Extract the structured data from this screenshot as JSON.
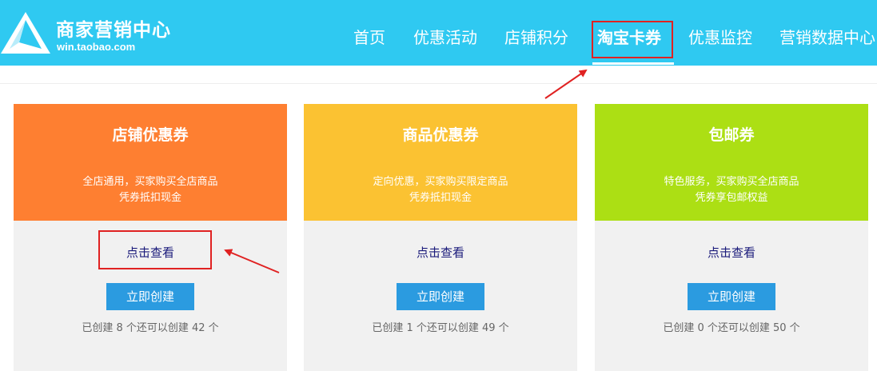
{
  "header": {
    "logo_title": "商家营销中心",
    "logo_url": "win.taobao.com",
    "nav": [
      {
        "label": "首页"
      },
      {
        "label": "优惠活动"
      },
      {
        "label": "店铺积分"
      },
      {
        "label": "淘宝卡券",
        "active": true
      },
      {
        "label": "优惠监控"
      },
      {
        "label": "营销数据中心"
      }
    ]
  },
  "cards": [
    {
      "title": "店铺优惠券",
      "desc_line1": "全店通用，买家购买全店商品",
      "desc_line2": "凭券抵扣现金",
      "view_label": "点击查看",
      "create_label": "立即创建",
      "count_text": "已创建 8 个还可以创建 42 个",
      "color": "#fe7f31"
    },
    {
      "title": "商品优惠券",
      "desc_line1": "定向优惠，买家购买限定商品",
      "desc_line2": "凭券抵扣现金",
      "view_label": "点击查看",
      "create_label": "立即创建",
      "count_text": "已创建 1 个还可以创建 49 个",
      "color": "#fbc232"
    },
    {
      "title": "包邮券",
      "desc_line1": "特色服务，买家购买全店商品",
      "desc_line2": "凭券享包邮权益",
      "view_label": "点击查看",
      "create_label": "立即创建",
      "count_text": "已创建 0 个还可以创建 50 个",
      "color": "#acdf14"
    }
  ],
  "colors": {
    "header_bg": "#2fc9f1",
    "annotation_red": "#e02222",
    "button_blue": "#2b9be0",
    "card_body": "#f1f1f1"
  }
}
